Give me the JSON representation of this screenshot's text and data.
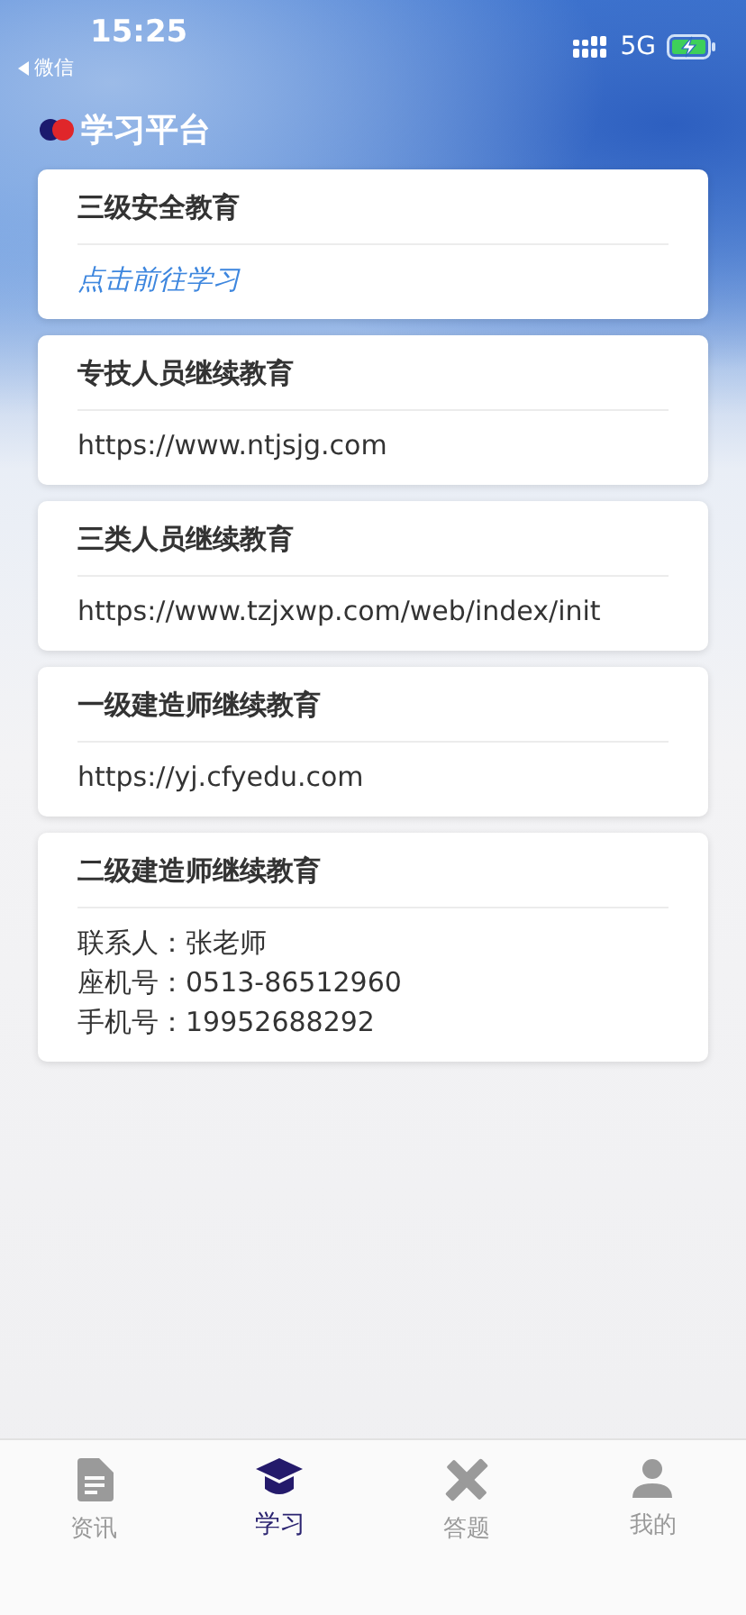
{
  "status_bar": {
    "time": "15:25",
    "back_label": "微信",
    "network": "5G"
  },
  "header": {
    "title": "学习平台"
  },
  "cards": [
    {
      "title": "三级安全教育",
      "lines": [
        {
          "kind": "link",
          "text": "点击前往学习"
        }
      ]
    },
    {
      "title": "专技人员继续教育",
      "lines": [
        {
          "kind": "text",
          "text": "https://www.ntjsjg.com"
        }
      ]
    },
    {
      "title": "三类人员继续教育",
      "lines": [
        {
          "kind": "text",
          "text": "https://www.tzjxwp.com/web/index/init"
        }
      ]
    },
    {
      "title": "一级建造师继续教育",
      "lines": [
        {
          "kind": "text",
          "text": "https://yj.cfyedu.com"
        }
      ]
    },
    {
      "title": "二级建造师继续教育",
      "lines": [
        {
          "kind": "text",
          "text": "联系人：张老师"
        },
        {
          "kind": "text",
          "text": "座机号：0513-86512960"
        },
        {
          "kind": "text",
          "text": "手机号：19952688292"
        }
      ]
    }
  ],
  "tabs": [
    {
      "label": "资讯",
      "selected": false
    },
    {
      "label": "学习",
      "selected": true
    },
    {
      "label": "答题",
      "selected": false
    },
    {
      "label": "我的",
      "selected": false
    }
  ]
}
